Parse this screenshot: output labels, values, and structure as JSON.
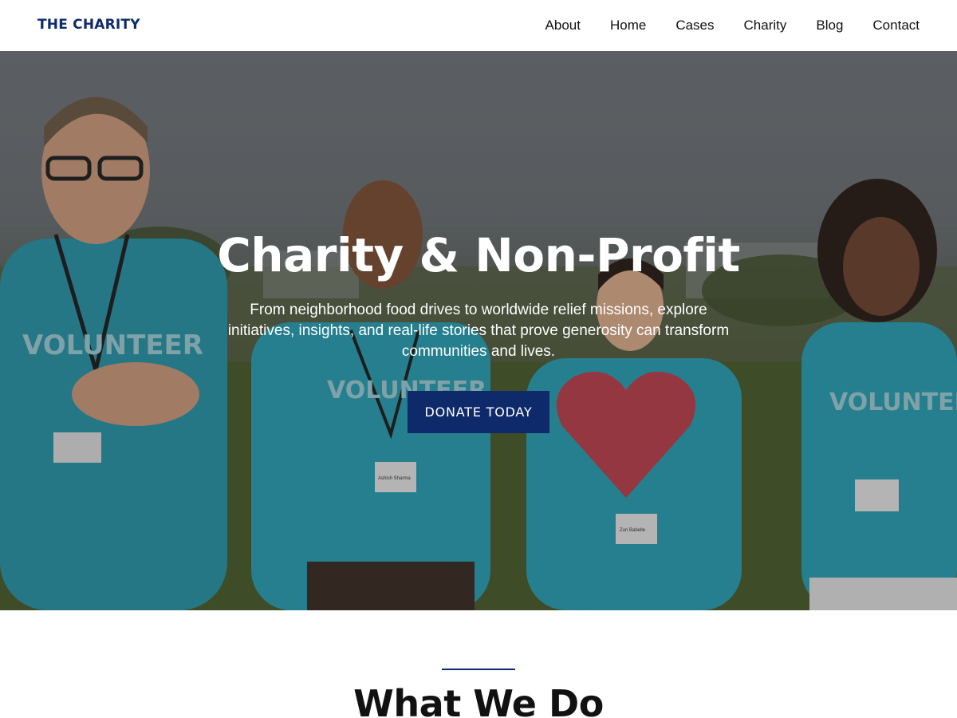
{
  "header": {
    "logo": "THE CHARITY",
    "nav": [
      {
        "label": "About"
      },
      {
        "label": "Home"
      },
      {
        "label": "Cases"
      },
      {
        "label": "Charity"
      },
      {
        "label": "Blog"
      },
      {
        "label": "Contact"
      }
    ]
  },
  "hero": {
    "title": "Charity & Non-Profit",
    "subtitle": "From neighborhood food drives to worldwide relief missions, explore initiatives, insights, and real-life stories that prove generosity can transform communities and lives.",
    "cta_label": "DONATE TODAY",
    "image": {
      "shirt_text": "VOLUNTEER",
      "badge_names": [
        "Ashish Sharma",
        "Zuri Babelle"
      ]
    }
  },
  "section": {
    "title": "What We Do"
  },
  "colors": {
    "brand": "#0f2a6b",
    "shirt": "#2a9db0",
    "heart": "#c0404f"
  }
}
